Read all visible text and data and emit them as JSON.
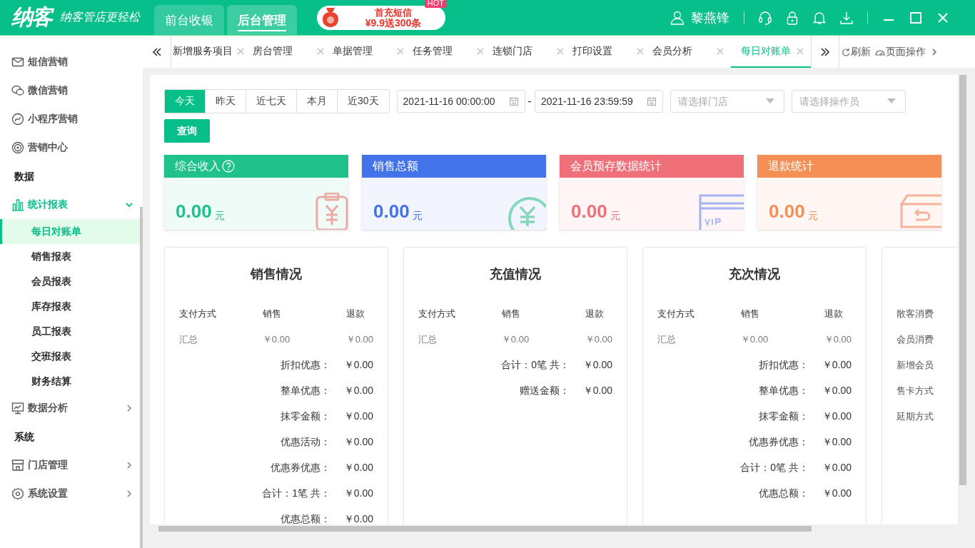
{
  "header": {
    "logo": "纳客",
    "slogan": "纳客管店更轻松",
    "nav": [
      {
        "label": "前台收银",
        "selected": false
      },
      {
        "label": "后台管理",
        "selected": true
      }
    ],
    "promo": {
      "title": "首充短信",
      "offer": "¥9.9送300条",
      "badge": "HOT"
    },
    "user": "黎燕锋"
  },
  "sidebar": {
    "items": [
      {
        "kind": "link",
        "label": "短信营销"
      },
      {
        "kind": "link",
        "label": "微信营销"
      },
      {
        "kind": "link",
        "label": "小程序营销"
      },
      {
        "kind": "link",
        "label": "营销中心"
      },
      {
        "kind": "heading",
        "label": "数据"
      },
      {
        "kind": "menu",
        "label": "统计报表",
        "expanded": true,
        "children": [
          {
            "label": "每日对账单",
            "selected": true
          },
          {
            "label": "销售报表",
            "selected": false
          },
          {
            "label": "会员报表",
            "selected": false
          },
          {
            "label": "库存报表",
            "selected": false
          },
          {
            "label": "员工报表",
            "selected": false
          },
          {
            "label": "交班报表",
            "selected": false
          },
          {
            "label": "财务结算",
            "selected": false
          }
        ]
      },
      {
        "kind": "menu",
        "label": "数据分析",
        "expanded": false
      },
      {
        "kind": "heading",
        "label": "系统"
      },
      {
        "kind": "menu",
        "label": "门店管理",
        "expanded": false
      },
      {
        "kind": "menu",
        "label": "系统设置",
        "expanded": false
      }
    ]
  },
  "tabs": [
    {
      "label": "新增服务项目",
      "selected": false
    },
    {
      "label": "房台管理",
      "selected": false
    },
    {
      "label": "单据管理",
      "selected": false
    },
    {
      "label": "任务管理",
      "selected": false
    },
    {
      "label": "连锁门店",
      "selected": false
    },
    {
      "label": "打印设置",
      "selected": false
    },
    {
      "label": "会员分析",
      "selected": false
    },
    {
      "label": "每日对账单",
      "selected": true
    }
  ],
  "toolbar": {
    "refresh": "刷新",
    "page_actions": "页面操作"
  },
  "filter": {
    "ranges": [
      {
        "label": "今天",
        "selected": true
      },
      {
        "label": "昨天",
        "selected": false
      },
      {
        "label": "近七天",
        "selected": false
      },
      {
        "label": "本月",
        "selected": false
      },
      {
        "label": "近30天",
        "selected": false
      }
    ],
    "start": "2021-11-16 00:00:00",
    "separator": "-",
    "end": "2021-11-16 23:59:59",
    "store": {
      "placeholder": "请选择门店"
    },
    "operator": {
      "placeholder": "请选择操作员"
    },
    "query": "查询"
  },
  "cards": [
    {
      "title": "综合收入",
      "help": true,
      "value": "0.00",
      "unit": "元",
      "color": "#1fc28a"
    },
    {
      "title": "销售总额",
      "help": false,
      "value": "0.00",
      "unit": "元",
      "color": "#4273ea"
    },
    {
      "title": "会员预存数据统计",
      "help": false,
      "value": "0.00",
      "unit": "元",
      "color": "#f0707a"
    },
    {
      "title": "退款统计",
      "help": false,
      "value": "0.00",
      "unit": "元",
      "color": "#f58f55"
    }
  ],
  "panels": [
    {
      "kind": "table",
      "title": "销售情况",
      "columns": [
        "支付方式",
        "销售",
        "退款"
      ],
      "rows": [
        [
          "汇总",
          "￥0.00",
          "￥0.00"
        ]
      ],
      "totals": [
        {
          "label": "折扣优惠：",
          "value": "￥0.00"
        },
        {
          "label": "整单优惠：",
          "value": "￥0.00"
        },
        {
          "label": "抹零金额：",
          "value": "￥0.00"
        },
        {
          "label": "优惠活动：",
          "value": "￥0.00"
        },
        {
          "label": "优惠券优惠：",
          "value": "￥0.00"
        },
        {
          "label": "合计：1笔 共：",
          "value": "￥0.00"
        },
        {
          "label": "优惠总额：",
          "value": "￥0.00"
        }
      ]
    },
    {
      "kind": "table",
      "title": "充值情况",
      "columns": [
        "支付方式",
        "销售",
        "退款"
      ],
      "rows": [
        [
          "汇总",
          "￥0.00",
          "￥0.00"
        ]
      ],
      "totals": [
        {
          "label": "合计：0笔 共：",
          "value": "￥0.00"
        },
        {
          "label": "赠送金额：",
          "value": "￥0.00"
        }
      ]
    },
    {
      "kind": "table",
      "title": "充次情况",
      "columns": [
        "支付方式",
        "销售",
        "退款"
      ],
      "rows": [
        [
          "汇总",
          "￥0.00",
          "￥0.00"
        ]
      ],
      "totals": [
        {
          "label": "折扣优惠：",
          "value": "￥0.00"
        },
        {
          "label": "整单优惠：",
          "value": "￥0.00"
        },
        {
          "label": "抹零金额：",
          "value": "￥0.00"
        },
        {
          "label": "优惠券优惠：",
          "value": "￥0.00"
        },
        {
          "label": "合计：0笔 共：",
          "value": "￥0.00"
        },
        {
          "label": "优惠总额：",
          "value": "￥0.00"
        }
      ]
    },
    {
      "kind": "list",
      "items": [
        "散客消费",
        "会员消费",
        "新增会员",
        "售卡方式",
        "延期方式"
      ]
    }
  ]
}
